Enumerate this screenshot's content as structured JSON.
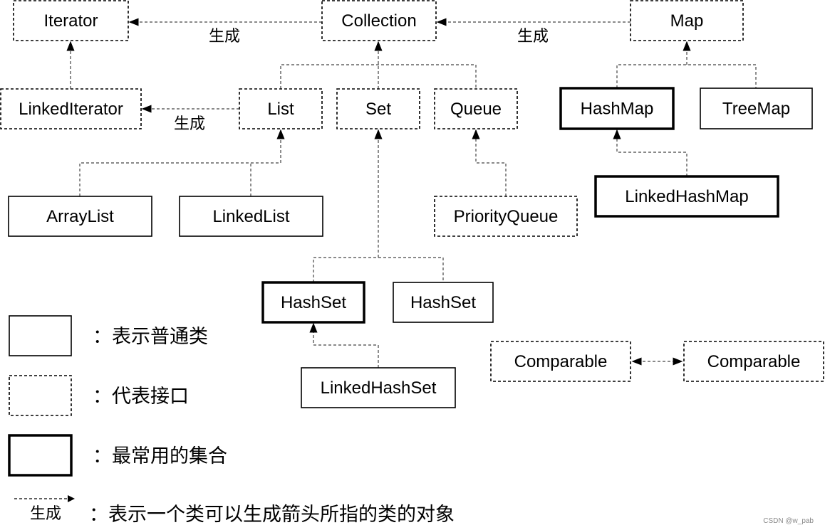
{
  "nodes": {
    "iterator": {
      "label": "Iterator",
      "kind": "interface"
    },
    "collection": {
      "label": "Collection",
      "kind": "interface"
    },
    "map": {
      "label": "Map",
      "kind": "interface"
    },
    "linked_iterator": {
      "label": "LinkedIterator",
      "kind": "interface"
    },
    "list": {
      "label": "List",
      "kind": "interface"
    },
    "set": {
      "label": "Set",
      "kind": "interface"
    },
    "queue": {
      "label": "Queue",
      "kind": "interface"
    },
    "hashmap": {
      "label": "HashMap",
      "kind": "common"
    },
    "treemap": {
      "label": "TreeMap",
      "kind": "class"
    },
    "arraylist": {
      "label": "ArrayList",
      "kind": "class"
    },
    "linkedlist": {
      "label": "LinkedList",
      "kind": "class"
    },
    "priorityqueue": {
      "label": "PriorityQueue",
      "kind": "interface"
    },
    "linkedhashmap": {
      "label": "LinkedHashMap",
      "kind": "common"
    },
    "hashset": {
      "label": "HashSet",
      "kind": "common"
    },
    "hashset2": {
      "label": "HashSet",
      "kind": "class"
    },
    "comparable1": {
      "label": "Comparable",
      "kind": "interface"
    },
    "comparable2": {
      "label": "Comparable",
      "kind": "interface"
    },
    "linkedhashset": {
      "label": "LinkedHashSet",
      "kind": "class"
    }
  },
  "edge_labels": {
    "collection_iterator": "生成",
    "map_collection": "生成",
    "list_linkediterator": "生成"
  },
  "legend": {
    "class": "：表示普通类",
    "interface": "：代表接口",
    "common": "：最常用的集合",
    "arrow_label": "生成",
    "arrow": "：表示一个类可以生成箭头所指的类的对象"
  },
  "watermark": "CSDN @w_pab"
}
